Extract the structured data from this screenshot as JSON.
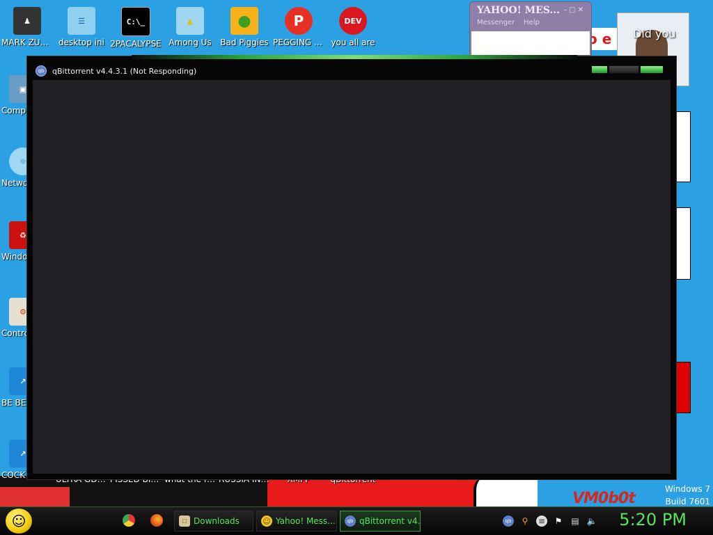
{
  "desktop_icons_top": [
    {
      "label": "MARK ZUCKERBERG",
      "icon": "person-icon"
    },
    {
      "label": "desktop ini",
      "icon": "notepad-icon"
    },
    {
      "label": "2PACALYPSE",
      "icon": "terminal-icon"
    },
    {
      "label": "Among Us",
      "icon": "among-us-icon"
    },
    {
      "label": "Bad Piggies",
      "icon": "bad-piggies-icon"
    },
    {
      "label": "PEGGING SIMULATOR",
      "icon": "pegging-icon"
    },
    {
      "label": "you all are",
      "icon": "dev-cpp-icon"
    }
  ],
  "desktop_icons_left": [
    {
      "label": "Computer",
      "icon": "computer-icon"
    },
    {
      "label": "Network",
      "icon": "network-icon"
    },
    {
      "label": "Windows Vista",
      "icon": "vista-icon"
    },
    {
      "label": "Control Panel",
      "icon": "control-panel-icon"
    },
    {
      "label": "BE BE",
      "icon": "shortcut-icon"
    },
    {
      "label": "COCK CLEANER",
      "icon": "shortcut-icon"
    }
  ],
  "desktop_icons_bottom": [
    {
      "label": "ULTRA GD BLOATWARE",
      "icon": "shortcut-icon"
    },
    {
      "label": "PISSED BIRDS IN ...",
      "icon": "shortcut-icon"
    },
    {
      "label": "what the fuck is goi...",
      "icon": "shortcut-icon"
    },
    {
      "label": "RUSSIA INVADES ...",
      "icon": "shortcut-icon"
    },
    {
      "label": "XMPP",
      "icon": "shortcut-icon"
    },
    {
      "label": "qBittorrent",
      "icon": "shortcut-icon"
    }
  ],
  "yahoo": {
    "title": "YAHOO! MES...",
    "menu_messenger": "Messenger",
    "menu_help": "Help"
  },
  "background": {
    "photo_text": "Did you",
    "red_text": "o e",
    "vm_logo": "VM0b0t",
    "windows_version": "Windows 7",
    "build": "Build 7601"
  },
  "qbittorrent": {
    "title": "qBittorrent v4.4.3.1 (Not Responding)",
    "app_icon_text": "qb"
  },
  "taskbar": {
    "buttons": [
      {
        "label": "Downloads",
        "icon": "folder-icon"
      },
      {
        "label": "Yahoo! Mess...",
        "icon": "yahoo-icon"
      },
      {
        "label": "qBittorrent v4...",
        "icon": "qbittorrent-icon"
      }
    ],
    "clock": "5:20 PM"
  },
  "colors": {
    "accent_green": "#55e45a",
    "desktop_blue": "#2ba1e4",
    "window_client": "#1f2024"
  }
}
